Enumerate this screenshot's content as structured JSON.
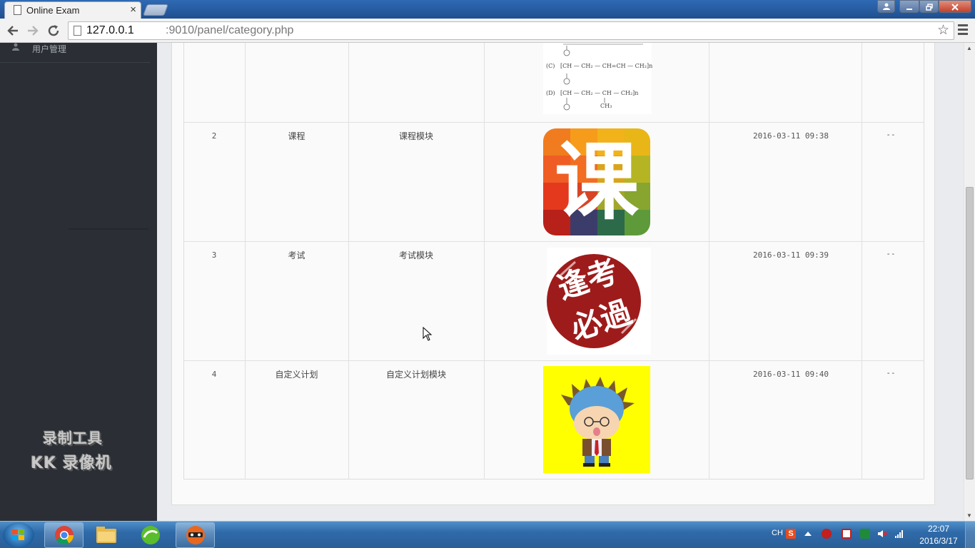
{
  "browser": {
    "tab_title": "Online Exam",
    "tab_close": "×",
    "url_host": "127.0.0.1",
    "url_rest": ":9010/panel/category.php",
    "star": "☆"
  },
  "sidebar": {
    "items": [
      {
        "label": "用户管理",
        "icon": "user-icon"
      }
    ],
    "watermark_line1": "录制工具",
    "watermark_line2": "KK 录像机"
  },
  "table": {
    "rows": [
      {
        "id": "2",
        "name": "课程",
        "description": "课程模块",
        "image": "course-icon",
        "image_text": "课",
        "created": "2016-03-11 09:38",
        "action": "--"
      },
      {
        "id": "3",
        "name": "考试",
        "description": "考试模块",
        "image": "exam-stamp-icon",
        "image_text": "逢考必過",
        "created": "2016-03-11 09:39",
        "action": "--"
      },
      {
        "id": "4",
        "name": "自定义计划",
        "description": "自定义计划模块",
        "image": "cartoon-avatar",
        "image_text": "",
        "created": "2016-03-11 09:40",
        "action": "--"
      }
    ],
    "chem_formulas": {
      "c_label": "(C)",
      "c_formula": "[CH — CH₂ — CH=CH — CH₂]n",
      "d_label": "(D)",
      "d_formula": "[CH — CH₂ — CH — CH₂]n",
      "d_sub": "CH₃"
    }
  },
  "taskbar": {
    "lang": "CH",
    "time": "22:07",
    "date": "2016/3/17"
  },
  "colors": {
    "sidebar_bg": "#2b2f35",
    "content_bg": "#e9ebee",
    "taskbar_blue": "#2f6aa9",
    "stamp_red": "#9e1b1b",
    "avatar_bg": "#ffff00"
  }
}
